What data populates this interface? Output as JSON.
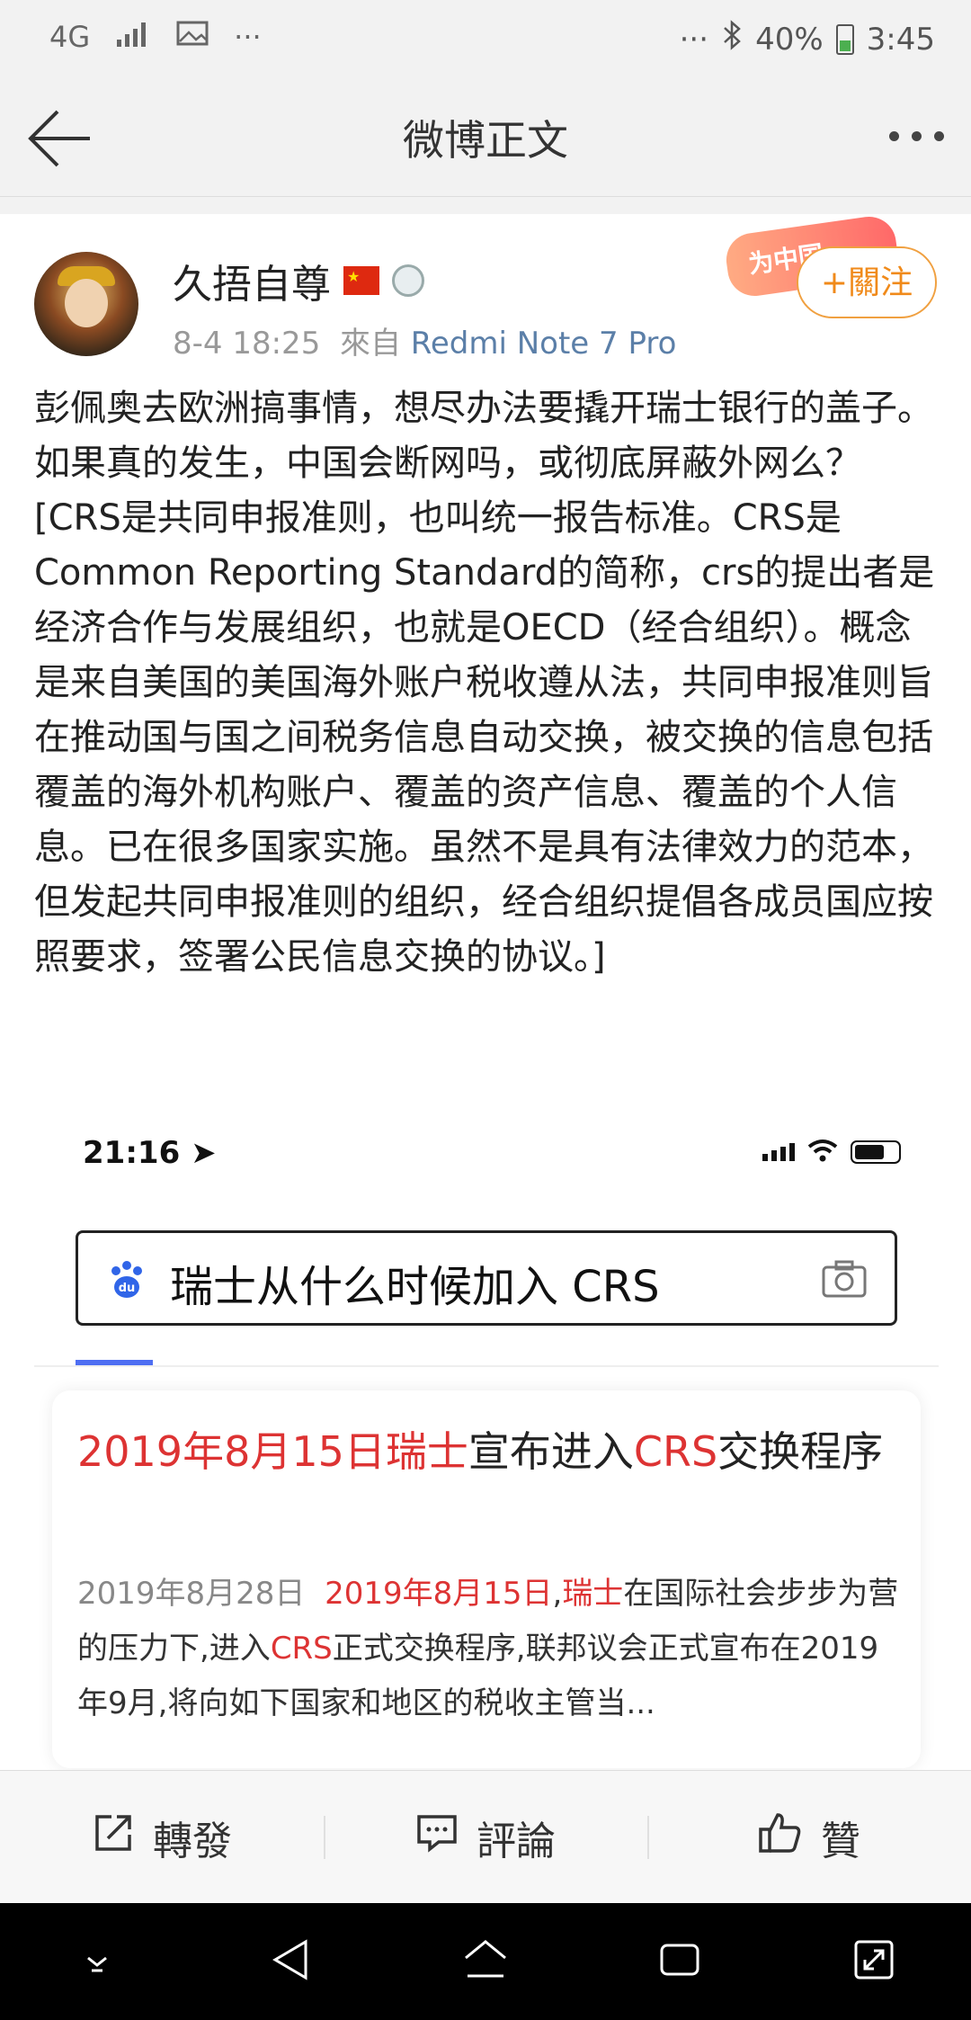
{
  "status_bar": {
    "network": "4G",
    "dots_left": "···",
    "dots_right": "···",
    "battery_percent": "40%",
    "time": "3:45"
  },
  "header": {
    "title": "微博正文"
  },
  "post": {
    "username": "久捂自尊",
    "timestamp": "8-4 18:25",
    "source_prefix": "來自",
    "source": "Redmi Note 7 Pro",
    "follow_label": "+關注",
    "badge_text": "为中国",
    "paragraph1": "彭佩奥去欧洲搞事情，想尽办法要撬开瑞士银行的盖子。如果真的发生，中国会断网吗，或彻底屏蔽外网么？",
    "paragraph2": "[CRS是共同申报准则，也叫统一报告标准。CRS是Common Reporting Standard的简称，crs的提出者是经济合作与发展组织，也就是OECD（经合组织）。概念是来自美国的美国海外账户税收遵从法，共同申报准则旨在推动国与国之间税务信息自动交换，被交换的信息包括覆盖的海外机构账户、覆盖的资产信息、覆盖的个人信息。已在很多国家实施。虽然不是具有法律效力的范本，但发起共同申报准则的组织，经合组织提倡各成员国应按照要求，签署公民信息交换的协议。]"
  },
  "embedded_screenshot": {
    "time": "21:16",
    "search_query": "瑞士从什么时候加入 CRS",
    "result": {
      "title_hl1": "2019年8月15日瑞士",
      "title_mid": "宣布进入",
      "title_hl2": "CRS",
      "title_end": "交换程序",
      "date": "2019年8月28日",
      "desc_hl1": "2019年8月15日",
      "desc_sep": ",",
      "desc_hl2": "瑞士",
      "desc_mid": "在国际社会步步为营的压力下,进入",
      "desc_hl3": "CRS",
      "desc_end": "正式交换程序,联邦议会正式宣布在2019年9月,将向如下国家和地区的税收主管当..."
    }
  },
  "actions": {
    "repost": "轉發",
    "comment": "評論",
    "like": "贊"
  }
}
